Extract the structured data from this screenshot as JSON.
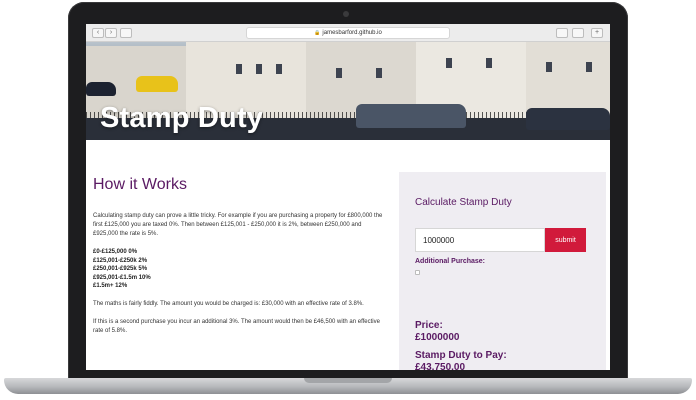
{
  "browser": {
    "url": "jamesbarford.github.io"
  },
  "hero": {
    "title": "Stamp Duty"
  },
  "how_it_works": {
    "heading": "How it Works",
    "intro": "Calculating stamp duty can prove a little tricky. For example if you are purchasing a property for £800,000 the first £125,000 you are taxed 0%. Then between £125,001 - £250,000 it is 2%, between £250,000 and £925,000 the rate is 5%.",
    "rates": [
      "£0-£125,000 0%",
      "£125,001-£250k 2%",
      "£250,001-£925k 5%",
      "£925,001-£1.5m 10%",
      "£1.5m+ 12%"
    ],
    "example": "The maths is fairly fiddly. The amount you would be charged is: £30,000 with an effective rate of 3.8%.",
    "second_purchase": "If this is a second purchase you incur an additional 3%. The amount would then be £46,500 with an effective rate of 5.8%."
  },
  "calculator": {
    "title": "Calculate Stamp Duty",
    "price_value": "1000000",
    "submit_label": "submit",
    "additional_label": "Additional Purchase:",
    "additional_checked": false,
    "price_label": "Price:",
    "price_result": "£1000000",
    "duty_label": "Stamp Duty to Pay:",
    "duty_result": "£43,750.00"
  },
  "colors": {
    "accent_purple": "#5a1a63",
    "submit_red": "#d11a3b",
    "panel_bg": "#efedf2"
  }
}
